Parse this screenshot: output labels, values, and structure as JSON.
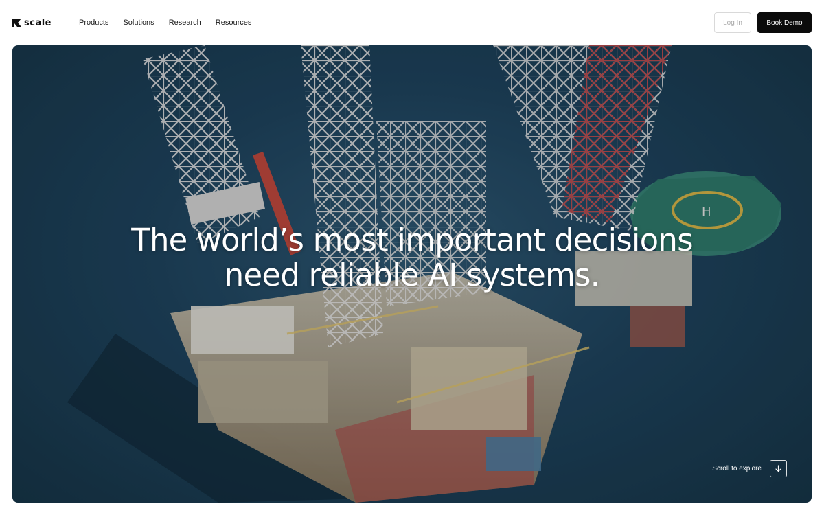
{
  "brand": {
    "name": "scale"
  },
  "nav": {
    "links": [
      {
        "label": "Products"
      },
      {
        "label": "Solutions"
      },
      {
        "label": "Research"
      },
      {
        "label": "Resources"
      }
    ],
    "login_label": "Log In",
    "demo_label": "Book Demo"
  },
  "hero": {
    "headline_line1": "The world’s most important decisions",
    "headline_line2": "need reliable AI systems.",
    "scroll_label": "Scroll to explore",
    "scroll_icon": "arrow-down-icon",
    "background_image": "offshore-oil-rig-aerial-photo"
  },
  "colors": {
    "primary_button": "#0b0b0b",
    "sea": "#1f4560",
    "text_on_hero": "#ffffff"
  }
}
